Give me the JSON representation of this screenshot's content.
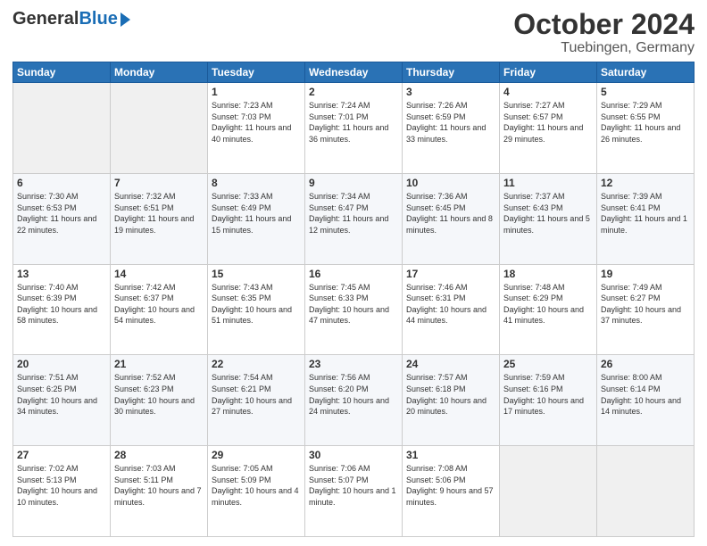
{
  "logo": {
    "general": "General",
    "blue": "Blue"
  },
  "title": "October 2024",
  "subtitle": "Tuebingen, Germany",
  "headers": [
    "Sunday",
    "Monday",
    "Tuesday",
    "Wednesday",
    "Thursday",
    "Friday",
    "Saturday"
  ],
  "weeks": [
    [
      {
        "day": "",
        "info": ""
      },
      {
        "day": "",
        "info": ""
      },
      {
        "day": "1",
        "info": "Sunrise: 7:23 AM\nSunset: 7:03 PM\nDaylight: 11 hours and 40 minutes."
      },
      {
        "day": "2",
        "info": "Sunrise: 7:24 AM\nSunset: 7:01 PM\nDaylight: 11 hours and 36 minutes."
      },
      {
        "day": "3",
        "info": "Sunrise: 7:26 AM\nSunset: 6:59 PM\nDaylight: 11 hours and 33 minutes."
      },
      {
        "day": "4",
        "info": "Sunrise: 7:27 AM\nSunset: 6:57 PM\nDaylight: 11 hours and 29 minutes."
      },
      {
        "day": "5",
        "info": "Sunrise: 7:29 AM\nSunset: 6:55 PM\nDaylight: 11 hours and 26 minutes."
      }
    ],
    [
      {
        "day": "6",
        "info": "Sunrise: 7:30 AM\nSunset: 6:53 PM\nDaylight: 11 hours and 22 minutes."
      },
      {
        "day": "7",
        "info": "Sunrise: 7:32 AM\nSunset: 6:51 PM\nDaylight: 11 hours and 19 minutes."
      },
      {
        "day": "8",
        "info": "Sunrise: 7:33 AM\nSunset: 6:49 PM\nDaylight: 11 hours and 15 minutes."
      },
      {
        "day": "9",
        "info": "Sunrise: 7:34 AM\nSunset: 6:47 PM\nDaylight: 11 hours and 12 minutes."
      },
      {
        "day": "10",
        "info": "Sunrise: 7:36 AM\nSunset: 6:45 PM\nDaylight: 11 hours and 8 minutes."
      },
      {
        "day": "11",
        "info": "Sunrise: 7:37 AM\nSunset: 6:43 PM\nDaylight: 11 hours and 5 minutes."
      },
      {
        "day": "12",
        "info": "Sunrise: 7:39 AM\nSunset: 6:41 PM\nDaylight: 11 hours and 1 minute."
      }
    ],
    [
      {
        "day": "13",
        "info": "Sunrise: 7:40 AM\nSunset: 6:39 PM\nDaylight: 10 hours and 58 minutes."
      },
      {
        "day": "14",
        "info": "Sunrise: 7:42 AM\nSunset: 6:37 PM\nDaylight: 10 hours and 54 minutes."
      },
      {
        "day": "15",
        "info": "Sunrise: 7:43 AM\nSunset: 6:35 PM\nDaylight: 10 hours and 51 minutes."
      },
      {
        "day": "16",
        "info": "Sunrise: 7:45 AM\nSunset: 6:33 PM\nDaylight: 10 hours and 47 minutes."
      },
      {
        "day": "17",
        "info": "Sunrise: 7:46 AM\nSunset: 6:31 PM\nDaylight: 10 hours and 44 minutes."
      },
      {
        "day": "18",
        "info": "Sunrise: 7:48 AM\nSunset: 6:29 PM\nDaylight: 10 hours and 41 minutes."
      },
      {
        "day": "19",
        "info": "Sunrise: 7:49 AM\nSunset: 6:27 PM\nDaylight: 10 hours and 37 minutes."
      }
    ],
    [
      {
        "day": "20",
        "info": "Sunrise: 7:51 AM\nSunset: 6:25 PM\nDaylight: 10 hours and 34 minutes."
      },
      {
        "day": "21",
        "info": "Sunrise: 7:52 AM\nSunset: 6:23 PM\nDaylight: 10 hours and 30 minutes."
      },
      {
        "day": "22",
        "info": "Sunrise: 7:54 AM\nSunset: 6:21 PM\nDaylight: 10 hours and 27 minutes."
      },
      {
        "day": "23",
        "info": "Sunrise: 7:56 AM\nSunset: 6:20 PM\nDaylight: 10 hours and 24 minutes."
      },
      {
        "day": "24",
        "info": "Sunrise: 7:57 AM\nSunset: 6:18 PM\nDaylight: 10 hours and 20 minutes."
      },
      {
        "day": "25",
        "info": "Sunrise: 7:59 AM\nSunset: 6:16 PM\nDaylight: 10 hours and 17 minutes."
      },
      {
        "day": "26",
        "info": "Sunrise: 8:00 AM\nSunset: 6:14 PM\nDaylight: 10 hours and 14 minutes."
      }
    ],
    [
      {
        "day": "27",
        "info": "Sunrise: 7:02 AM\nSunset: 5:13 PM\nDaylight: 10 hours and 10 minutes."
      },
      {
        "day": "28",
        "info": "Sunrise: 7:03 AM\nSunset: 5:11 PM\nDaylight: 10 hours and 7 minutes."
      },
      {
        "day": "29",
        "info": "Sunrise: 7:05 AM\nSunset: 5:09 PM\nDaylight: 10 hours and 4 minutes."
      },
      {
        "day": "30",
        "info": "Sunrise: 7:06 AM\nSunset: 5:07 PM\nDaylight: 10 hours and 1 minute."
      },
      {
        "day": "31",
        "info": "Sunrise: 7:08 AM\nSunset: 5:06 PM\nDaylight: 9 hours and 57 minutes."
      },
      {
        "day": "",
        "info": ""
      },
      {
        "day": "",
        "info": ""
      }
    ]
  ]
}
